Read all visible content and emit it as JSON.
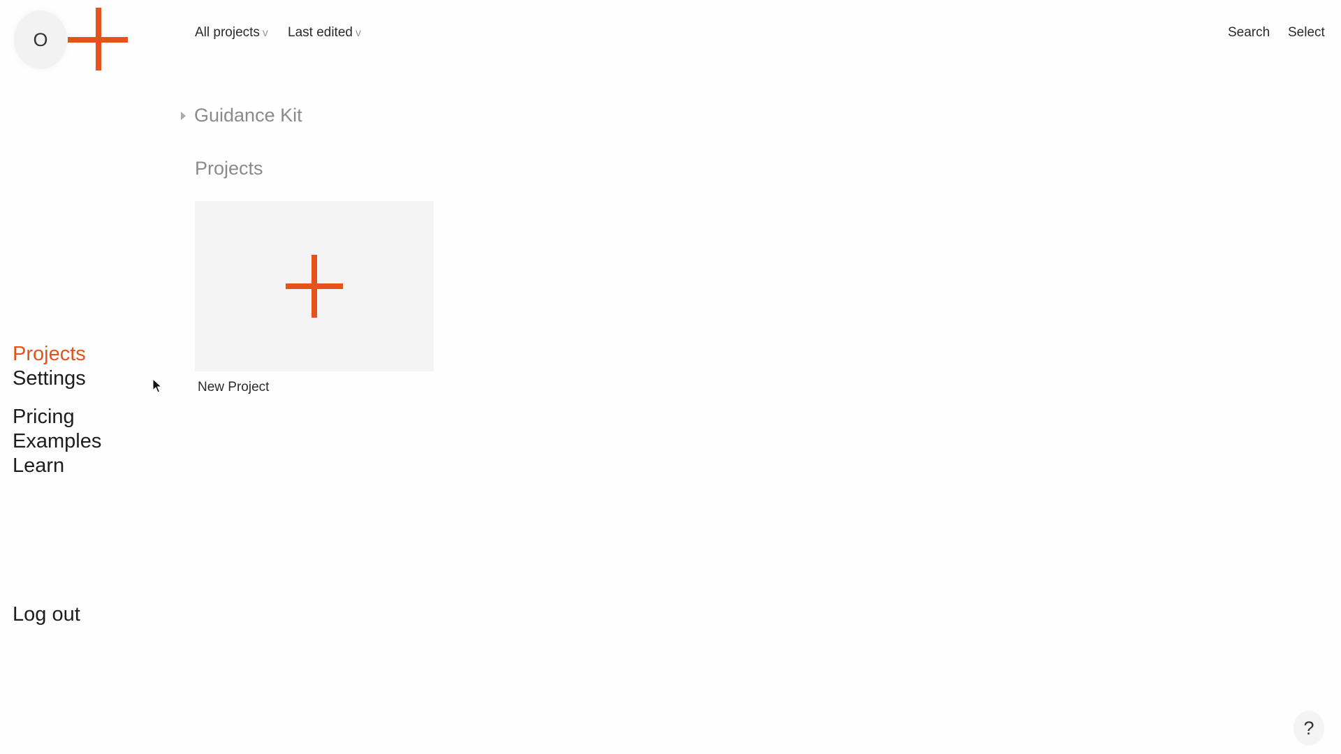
{
  "brand": {
    "avatar_initial": "O",
    "accent_color": "#e5521b"
  },
  "topbar": {
    "filter_all": "All projects",
    "filter_sort": "Last edited",
    "chevron": "v",
    "search": "Search",
    "select": "Select"
  },
  "sidebar": {
    "primary": [
      "Projects",
      "Settings"
    ],
    "secondary": [
      "Pricing",
      "Examples",
      "Learn"
    ],
    "logout": "Log out",
    "active": "Projects"
  },
  "main": {
    "kit_title": "Guidance Kit",
    "section_title": "Projects",
    "new_project_label": "New Project"
  },
  "help": "?"
}
